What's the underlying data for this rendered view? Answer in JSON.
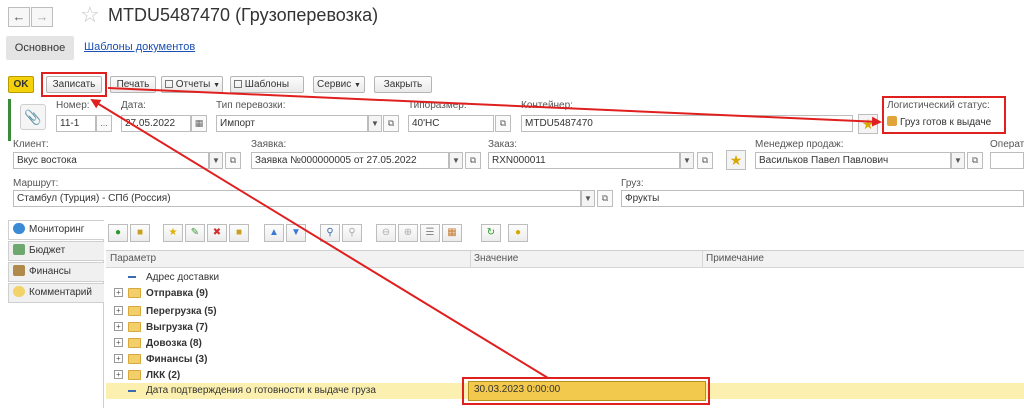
{
  "window": {
    "title": "MTDU5487470 (Грузоперевозка)"
  },
  "tabs": {
    "main": "Основное",
    "templates": "Шаблоны документов"
  },
  "toolbar": {
    "ok": "OK",
    "write": "Записать",
    "print": "Печать",
    "reports": "Отчеты",
    "templates": "Шаблоны",
    "service": "Сервис",
    "close": "Закрыть"
  },
  "form": {
    "number": {
      "label": "Номер:",
      "value": "11-1",
      "extra": "..."
    },
    "date": {
      "label": "Дата:",
      "value": "27.05.2022"
    },
    "transport_type": {
      "label": "Тип перевозки:",
      "value": "Импорт"
    },
    "size_type": {
      "label": "Типоразмер:",
      "value": "40'HC"
    },
    "container": {
      "label": "Контейнер:",
      "value": "MTDU5487470"
    },
    "logistic_status": {
      "label": "Логистический статус:",
      "value": "Груз готов к выдаче"
    },
    "client": {
      "label": "Клиент:",
      "value": "Вкус востока"
    },
    "request": {
      "label": "Заявка:",
      "value": "Заявка №000000005 от 27.05.2022"
    },
    "order": {
      "label": "Заказ:",
      "value": "RXN000011"
    },
    "sales_manager": {
      "label": "Менеджер продаж:",
      "value": "Васильков Павел Павлович"
    },
    "operator": {
      "label": "Операт"
    },
    "route": {
      "label": "Маршрут:",
      "value": "Стамбул (Турция) - СПб (Россия)"
    },
    "cargo": {
      "label": "Груз:",
      "value": "Фрукты"
    }
  },
  "side_tabs": [
    {
      "label": "Мониторинг",
      "icon": "globe-icon"
    },
    {
      "label": "Бюджет",
      "icon": "budget-icon"
    },
    {
      "label": "Финансы",
      "icon": "finance-icon"
    },
    {
      "label": "Комментарий",
      "icon": "comment-icon"
    }
  ],
  "grid": {
    "columns": [
      "Параметр",
      "Значение",
      "Примечание"
    ],
    "rows": [
      {
        "param": "Адрес доставки",
        "type": "leaf"
      },
      {
        "param": "Отправка (9)",
        "type": "group"
      },
      {
        "param": "Перегрузка (5)",
        "type": "group"
      },
      {
        "param": "Выгрузка (7)",
        "type": "group"
      },
      {
        "param": "Довозка (8)",
        "type": "group"
      },
      {
        "param": "Финансы (3)",
        "type": "group"
      },
      {
        "param": "ЛКК (2)",
        "type": "group"
      },
      {
        "param": "Дата подтверждения о готовности к выдаче груза",
        "value": "30.03.2023 0:00:00",
        "type": "leaf-selected"
      }
    ]
  },
  "colors": {
    "highlight_red": "#e01f1f",
    "ok_yellow": "#f3d20b",
    "selected_value": "#f2c94c",
    "link_blue": "#1a4fb3"
  }
}
